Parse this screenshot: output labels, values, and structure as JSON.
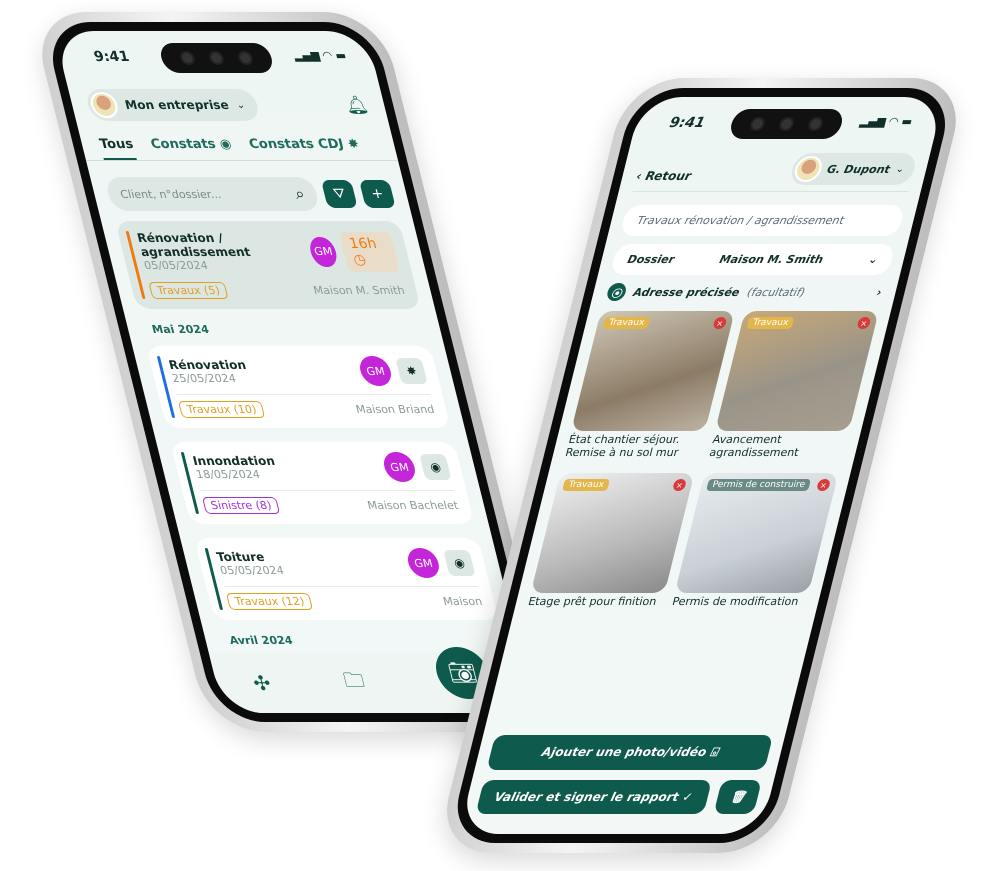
{
  "left_phone": {
    "time": "9:41",
    "company": "Mon entreprise",
    "tabs": [
      "Tous",
      "Constats",
      "Constats CDJ"
    ],
    "search_placeholder": "Client, n°dossier...",
    "featured": {
      "title": "Rénovation / agrandissement",
      "date": "05/05/2024",
      "initials": "GM",
      "time_badge": "16h",
      "tag": "Travaux (5)",
      "client": "Maison M. Smith"
    },
    "section_may": "Mai 2024",
    "items": [
      {
        "title": "Rénovation",
        "date": "25/05/2024",
        "initials": "GM",
        "tag": "Travaux (10)",
        "client": "Maison Briand",
        "bar": "#1d6fe0",
        "tagcolor": "#e0a020"
      },
      {
        "title": "Innondation",
        "date": "18/05/2024",
        "initials": "GM",
        "tag": "Sinistre (8)",
        "client": "Maison Bachelet",
        "bar": "#0e5a4c",
        "tagcolor": "#a030d8"
      },
      {
        "title": "Toiture",
        "date": "05/05/2024",
        "initials": "GM",
        "tag": "Travaux (12)",
        "client": "Maison",
        "bar": "#0e5a4c",
        "tagcolor": "#e0a020"
      }
    ],
    "section_april": "Avril 2024"
  },
  "right_phone": {
    "time": "9:41",
    "back": "‹ Retour",
    "user": "G. Dupont",
    "title_field": "Travaux rénovation / agrandissement",
    "dossier_label": "Dossier",
    "dossier_value": "Maison M. Smith",
    "address_label": "Adresse précisée",
    "address_optional": "(facultatif)",
    "photos": [
      {
        "label": "Travaux",
        "caption": "État chantier séjour. Remise à nu sol mur"
      },
      {
        "label": "Travaux",
        "caption": "Avancement agrandissement"
      },
      {
        "label": "Travaux",
        "caption": "Etage prêt pour finition"
      },
      {
        "label": "Permis de construire",
        "caption": "Permis de modification"
      }
    ],
    "add_photo": "Ajouter une photo/vidéo",
    "validate": "Valider et signer le rapport"
  },
  "colors": {
    "primary": "#0e5a4c",
    "orange": "#f07a10",
    "avatar": "#c425d8"
  }
}
